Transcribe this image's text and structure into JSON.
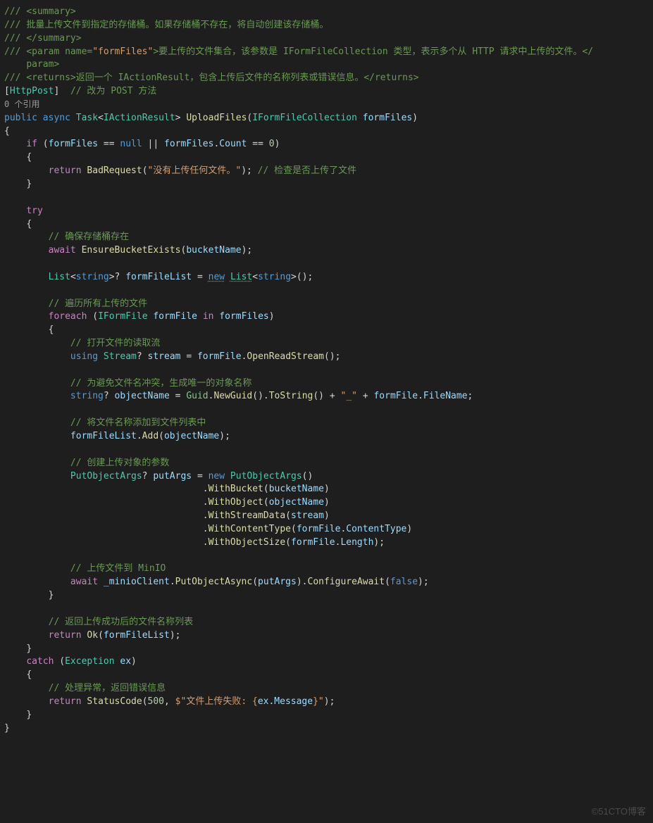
{
  "l1": "<summary>",
  "l2": "批量上传文件到指定的存储桶。如果存储桶不存在，将自动创建该存储桶。",
  "l3": "</summary>",
  "p1": "<param name=",
  "p2": "\"formFiles\"",
  "p3": ">要上传的文件集合，该参数是 IFormFileCollection 类型，表示多个从 HTTP 请求中上传的文件。",
  "p4": "</ ",
  "p5": "param>",
  "ret": "<returns>返回一个 IActionResult，包含上传后文件的名称列表或错误信息。</returns>",
  "attr": "HttpPost",
  "attrCmt": "// 改为 POST 方法",
  "codelens": "0 个引用",
  "sig": {
    "public": "public",
    "async": "async",
    "Task": "Task",
    "IActionResult": "IActionResult",
    "Upload": "UploadFiles",
    "IForm": "IFormFileCollection",
    "arg": "formFiles"
  },
  "ifline": {
    "if": "if",
    "ff": "formFiles",
    "null": "null",
    "count": "Count"
  },
  "badreq": {
    "return": "return",
    "fn": "BadRequest",
    "msg": "\"没有上传任何文件。\"",
    "cmt": "// 检查是否上传了文件"
  },
  "try": "try",
  "c1": "// 确保存储桶存在",
  "ensure": {
    "await": "await",
    "fn": "EnsureBucketExists",
    "bn": "bucketName"
  },
  "list": {
    "List": "List",
    "string": "string",
    "var": "formFileList",
    "new": "new",
    "List2": "List"
  },
  "c2": "// 遍历所有上传的文件",
  "foreach": {
    "foreach": "foreach",
    "IFormFile": "IFormFile",
    "ff": "formFile",
    "in": "in",
    "ffs": "formFiles"
  },
  "c3": "// 打开文件的读取流",
  "using": {
    "using": "using",
    "Stream": "Stream",
    "stream": "stream",
    "ff": "formFile",
    "fn": "OpenReadStream"
  },
  "c4": "// 为避免文件名冲突，生成唯一的对象名称",
  "obj": {
    "string": "string",
    "on": "objectName",
    "Guid": "Guid",
    "ng": "NewGuid",
    "ts": "ToString",
    "us": "\"_\"",
    "ff": "formFile",
    "fn": "FileName"
  },
  "c5": "// 将文件名称添加到文件列表中",
  "add": {
    "list": "formFileList",
    "fn": "Add",
    "on": "objectName"
  },
  "c6": "// 创建上传对象的参数",
  "put": {
    "POA": "PutObjectArgs",
    "pa": "putArgs",
    "new": "new",
    "POA2": "PutObjectArgs"
  },
  "wb": {
    "fn": "WithBucket",
    "bn": "bucketName"
  },
  "wo": {
    "fn": "WithObject",
    "on": "objectName"
  },
  "ws": {
    "fn": "WithStreamData",
    "s": "stream"
  },
  "wc": {
    "fn": "WithContentType",
    "ff": "formFile",
    "ct": "ContentType"
  },
  "wz": {
    "fn": "WithObjectSize",
    "ff": "formFile",
    "len": "Length"
  },
  "c7": "// 上传文件到 MinIO",
  "up": {
    "await": "await",
    "mc": "_minioClient",
    "po": "PutObjectAsync",
    "pa": "putArgs",
    "cw": "ConfigureAwait",
    "false": "false"
  },
  "c8": "// 返回上传成功后的文件名称列表",
  "ok": {
    "return": "return",
    "fn": "Ok",
    "list": "formFileList"
  },
  "catch": {
    "catch": "catch",
    "Exc": "Exception",
    "ex": "ex"
  },
  "c9": "// 处理异常，返回错误信息",
  "sc": {
    "return": "return",
    "fn": "StatusCode",
    "code": "500",
    "msg": "$\"文件上传失败: {",
    "ex": "ex",
    "m": "Message",
    "end": "}\""
  },
  "watermark": "©51CTO博客"
}
